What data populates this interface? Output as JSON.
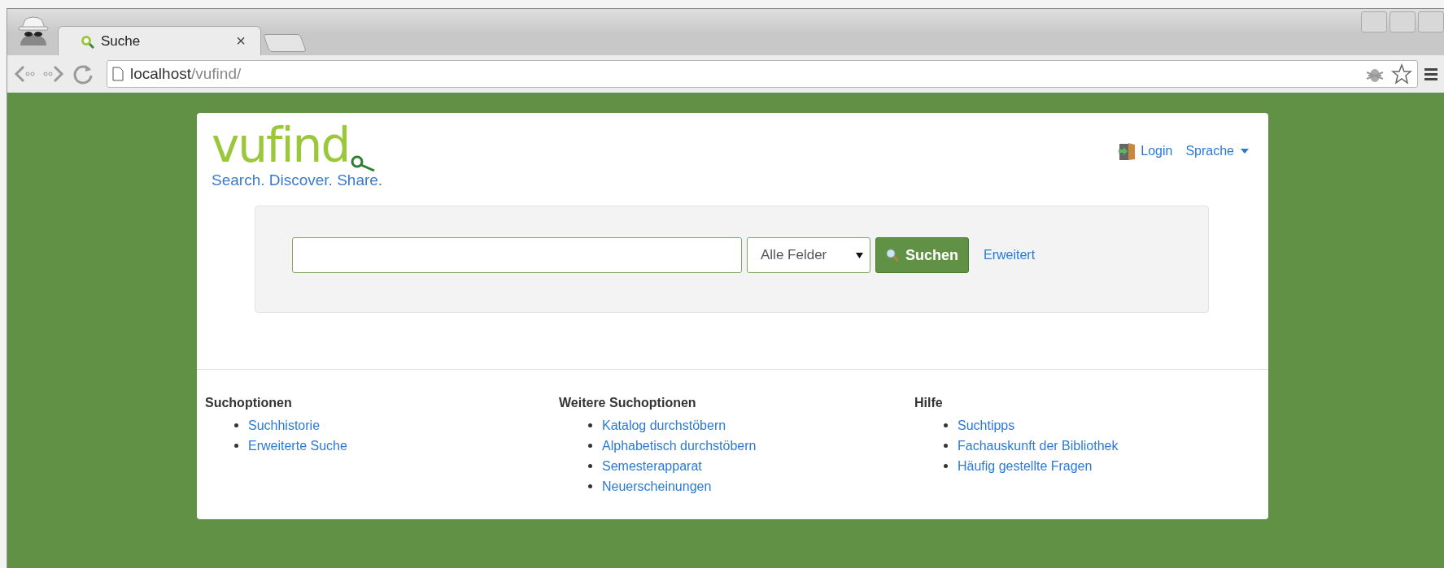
{
  "browser": {
    "tab": {
      "title": "Suche",
      "close": "×",
      "selected": true
    },
    "url": "**localhost**/vufind/"
  },
  "header": {
    "logo": "vufind",
    "tagline": "Search. Discover. Share.",
    "login": "Login",
    "language": "Sprache"
  },
  "search": {
    "scope": "Alle Felder",
    "button": "Suchen",
    "advanced": "Erweitert"
  },
  "footer": [
    {
      "heading": "Suchoptionen",
      "links": [
        "Suchhistorie",
        "Erweiterte Suche"
      ]
    },
    {
      "heading": "Weitere Suchoptionen",
      "links": [
        "Katalog durchstöbern",
        "Alphabetisch durchstöbern",
        "Semesterapparat",
        "Neuerscheinungen"
      ]
    },
    {
      "heading": "Hilfe",
      "links": [
        "Suchtipps",
        "Fachauskunft der Bibliothek",
        "Häufig gestellte Fragen"
      ]
    }
  ]
}
